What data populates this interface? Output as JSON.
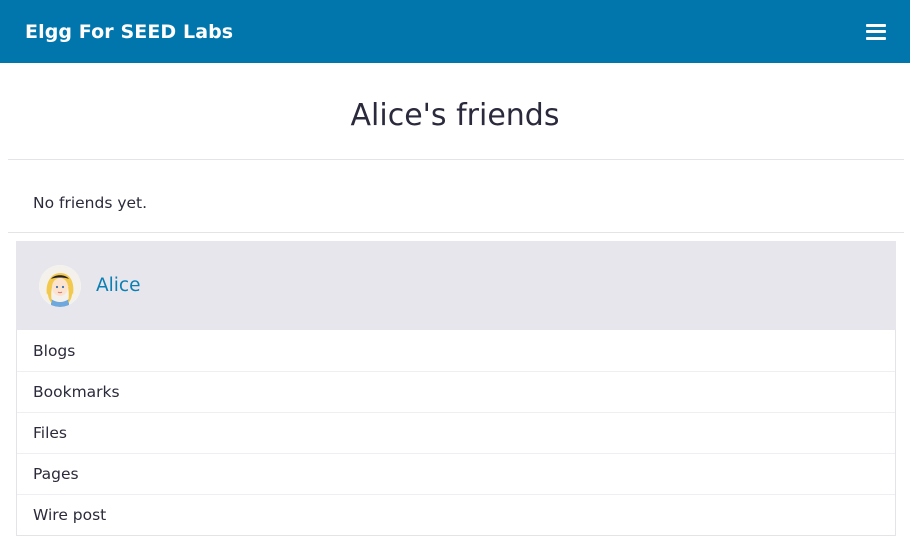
{
  "header": {
    "site_title": "Elgg For SEED Labs",
    "menu_icon": "hamburger-menu-icon",
    "bg_color": "#0076ad"
  },
  "page": {
    "title": "Alice's friends",
    "empty_message": "No friends yet."
  },
  "owner": {
    "name": "Alice",
    "avatar_icon": "alice-avatar",
    "link_color": "#0b7fb3"
  },
  "owner_menu": {
    "items": [
      {
        "label": "Blogs"
      },
      {
        "label": "Bookmarks"
      },
      {
        "label": "Files"
      },
      {
        "label": "Pages"
      },
      {
        "label": "Wire post"
      }
    ]
  }
}
